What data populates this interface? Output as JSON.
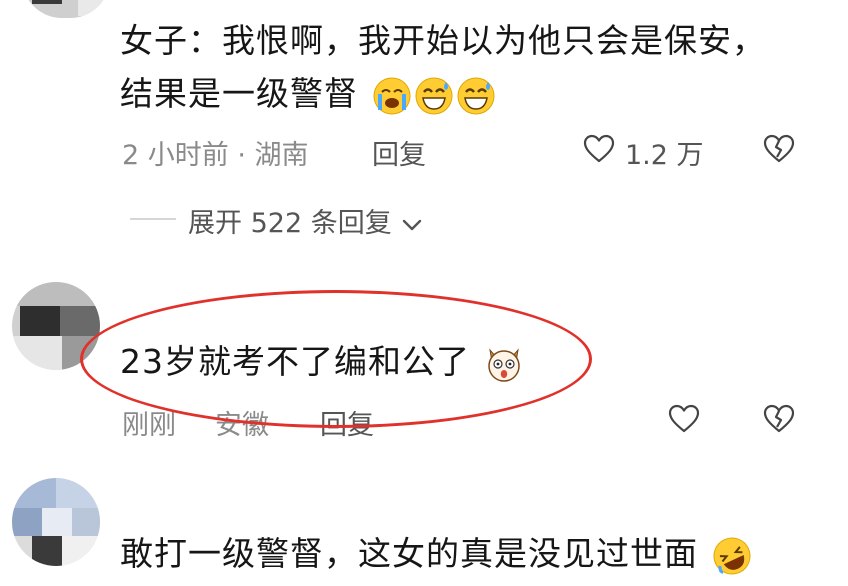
{
  "comments": [
    {
      "text_line1": "女子：我恨啊，我开始以为他只会是保安，",
      "text_line2": "结果是一级警督",
      "emojis": [
        "crying-face",
        "grinning-sweat-face",
        "grinning-sweat-face"
      ],
      "time": "2 小时前 · 湖南",
      "reply_label": "回复",
      "like_count": "1.2 万",
      "expand_label": "展开 522 条回复"
    },
    {
      "text": "23岁就考不了编和公了",
      "emoji": "shocked-dog-face",
      "time": "刚刚",
      "location": "安徽",
      "reply_label": "回复"
    },
    {
      "text": "敢打一级警督，这女的真是没见过世面",
      "emoji": "rofl-face"
    }
  ],
  "colors": {
    "highlight": "#e0312b",
    "meta_text": "#8a8a8a"
  }
}
